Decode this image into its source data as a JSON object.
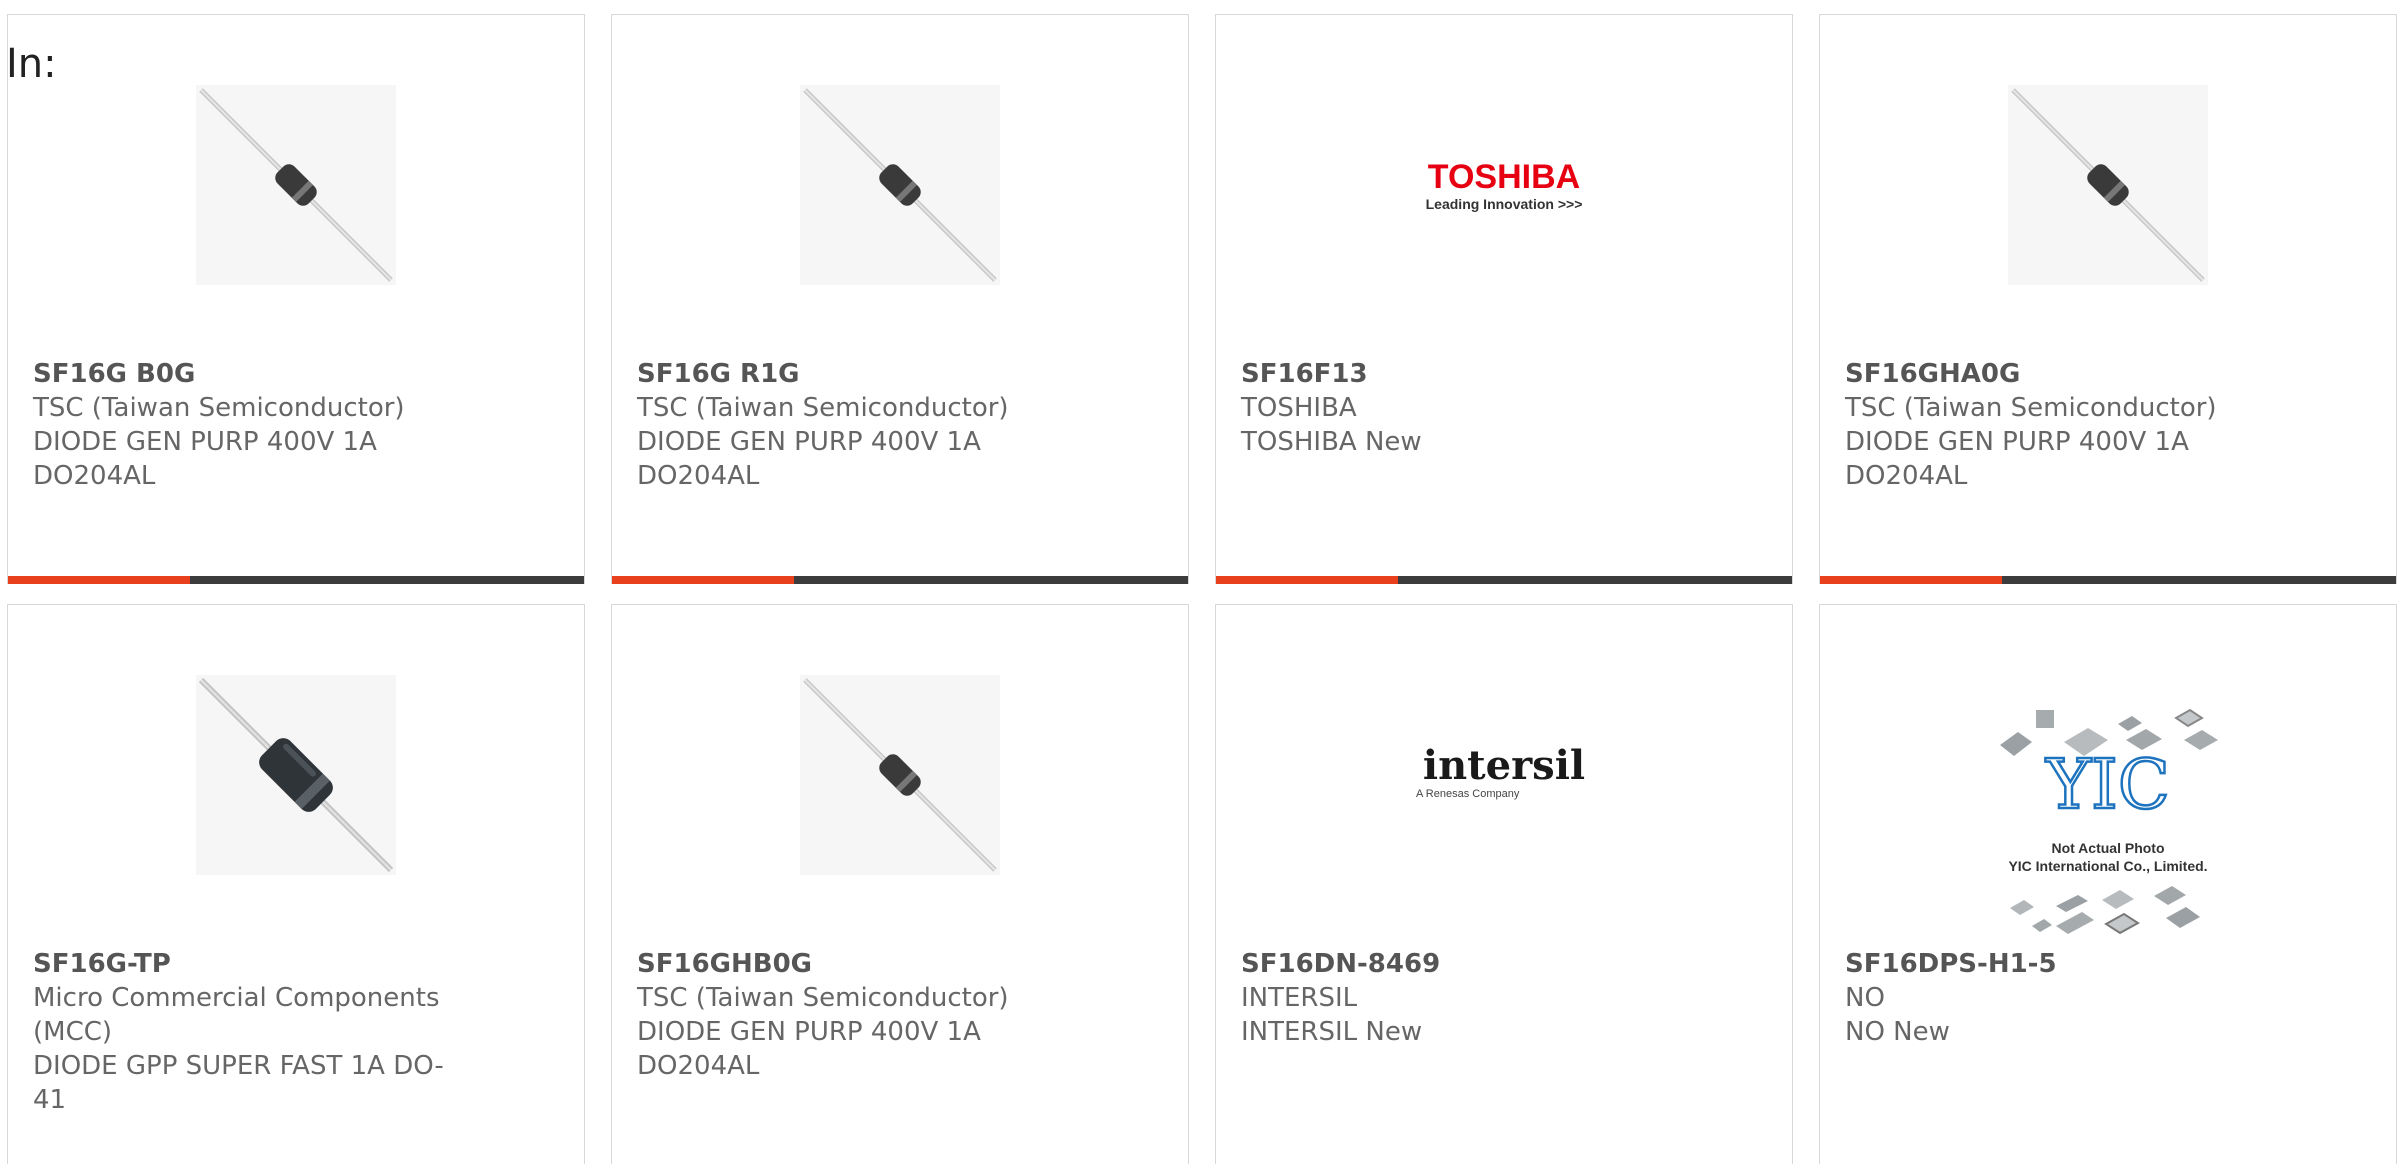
{
  "prefix_label": "In:",
  "products": [
    {
      "part_number": "SF16G B0G",
      "manufacturer": "TSC (Taiwan Semiconductor)",
      "description_lines": [
        "DIODE GEN PURP 400V 1A",
        "DO204AL"
      ],
      "image": "diode-axial"
    },
    {
      "part_number": "SF16G R1G",
      "manufacturer": "TSC (Taiwan Semiconductor)",
      "description_lines": [
        "DIODE GEN PURP 400V 1A",
        "DO204AL"
      ],
      "image": "diode-axial"
    },
    {
      "part_number": "SF16F13",
      "manufacturer": "TOSHIBA",
      "description_lines": [
        "TOSHIBA New"
      ],
      "image": "toshiba-logo",
      "logo_text": {
        "brand": "TOSHIBA",
        "tagline": "Leading Innovation >>>"
      }
    },
    {
      "part_number": "SF16GHA0G",
      "manufacturer": "TSC (Taiwan Semiconductor)",
      "description_lines": [
        "DIODE GEN PURP 400V 1A",
        "DO204AL"
      ],
      "image": "diode-axial"
    },
    {
      "part_number": "SF16G-TP",
      "manufacturer_lines": [
        "Micro Commercial Components",
        "(MCC)"
      ],
      "description_lines": [
        "DIODE GPP SUPER FAST 1A DO-",
        "41"
      ],
      "image": "diode-axial-large"
    },
    {
      "part_number": "SF16GHB0G",
      "manufacturer": "TSC (Taiwan Semiconductor)",
      "description_lines": [
        "DIODE GEN PURP 400V 1A",
        "DO204AL"
      ],
      "image": "diode-axial"
    },
    {
      "part_number": "SF16DN-8469",
      "manufacturer": "INTERSIL",
      "description_lines": [
        "INTERSIL New"
      ],
      "image": "intersil-logo",
      "logo_text": {
        "brand": "intersil",
        "tagline": "A Renesas Company"
      }
    },
    {
      "part_number": "SF16DPS-H1-5",
      "manufacturer": "NO",
      "description_lines": [
        "NO New"
      ],
      "image": "yic-placeholder",
      "logo_text": {
        "brand": "YIC",
        "line1": "Not Actual Photo",
        "line2": "YIC International Co., Limited."
      }
    }
  ],
  "colors": {
    "accent_bar": "#e8401c",
    "bar": "#3c3c3c",
    "toshiba_red": "#e60012",
    "yic_blue": "#1e73be"
  }
}
